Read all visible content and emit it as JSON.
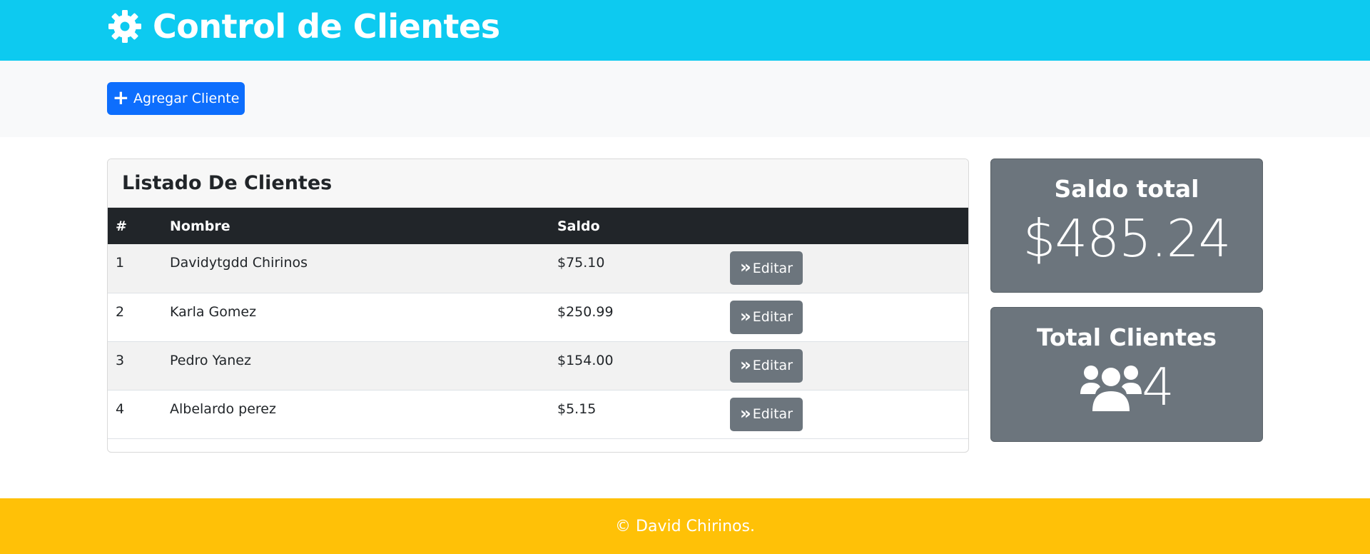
{
  "header": {
    "title": "Control de Clientes",
    "icon": "gear-icon",
    "background": "#0dcaf0"
  },
  "actions": {
    "add_label": "Agregar Cliente",
    "add_icon": "plus-icon",
    "button_color": "#0d6efd"
  },
  "client_list": {
    "title": "Listado De Clientes",
    "columns": [
      "#",
      "Nombre",
      "Saldo",
      ""
    ],
    "rows": [
      {
        "num": "1",
        "name": "Davidytgdd Chirinos",
        "saldo": "$75.10",
        "action": "Editar"
      },
      {
        "num": "2",
        "name": "Karla Gomez",
        "saldo": "$250.99",
        "action": "Editar"
      },
      {
        "num": "3",
        "name": "Pedro Yanez",
        "saldo": "$154.00",
        "action": "Editar"
      },
      {
        "num": "4",
        "name": "Albelardo perez",
        "saldo": "$5.15",
        "action": "Editar"
      }
    ],
    "edit_icon": "double-chevron-right-icon"
  },
  "stats": {
    "saldo_label": "Saldo total",
    "saldo_value": "$485.24",
    "clients_label": "Total Clientes",
    "clients_value": "4",
    "clients_icon": "users-icon",
    "card_color": "#6c757d"
  },
  "footer": {
    "text": "© David Chirinos.",
    "background": "#ffc107"
  }
}
